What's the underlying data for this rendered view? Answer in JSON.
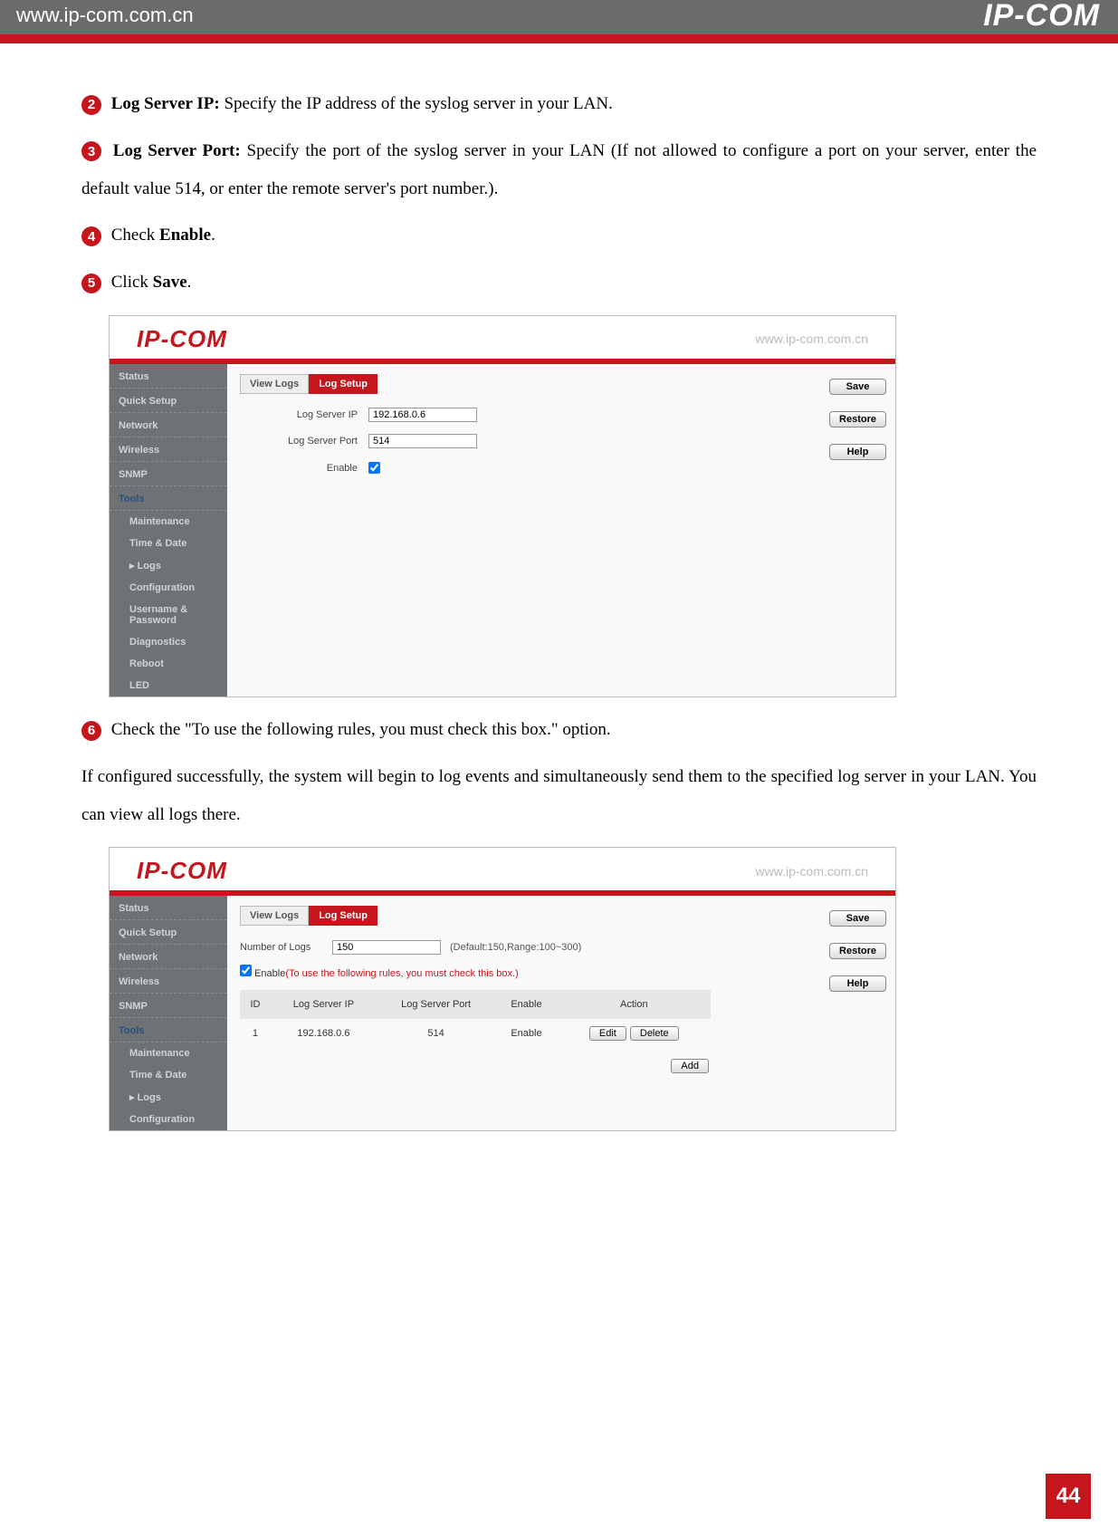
{
  "header": {
    "url": "www.ip-com.com.cn",
    "brand": "IP-COM"
  },
  "steps": {
    "s2_label": "Log Server IP:",
    "s2_text": " Specify the IP address of the syslog server in your LAN.",
    "s3_label": "Log Server Port:",
    "s3_text": " Specify the port of the syslog server in your LAN (If not allowed to configure a port on your server, enter the default value 514, or enter the remote server's port number.).",
    "s4_pre": "Check ",
    "s4_bold": "Enable",
    "s5_pre": "Click ",
    "s5_bold": "Save",
    "s6_text": " Check the \"To use the following rules, you must check this box.\" option.",
    "final": "If configured successfully, the system will begin to log events and simultaneously send them to the specified log server in your LAN. You can view all logs there."
  },
  "ss": {
    "logo": "IP-COM",
    "url": "www.ip-com.com.cn",
    "side": {
      "status": "Status",
      "quick": "Quick Setup",
      "network": "Network",
      "wireless": "Wireless",
      "snmp": "SNMP",
      "tools": "Tools",
      "maint": "Maintenance",
      "time": "Time & Date",
      "logs": "Logs",
      "config": "Configuration",
      "userpw": "Username & Password",
      "diag": "Diagnostics",
      "reboot": "Reboot",
      "led": "LED"
    },
    "tabs": {
      "view": "View Logs",
      "setup": "Log Setup"
    },
    "btn": {
      "save": "Save",
      "restore": "Restore",
      "help": "Help",
      "add": "Add",
      "edit": "Edit",
      "delete": "Delete"
    },
    "form1": {
      "ip_label": "Log Server IP",
      "ip_val": "192.168.0.6",
      "port_label": "Log Server Port",
      "port_val": "514",
      "enable_label": "Enable"
    },
    "form2": {
      "num_label": "Number of Logs",
      "num_val": "150",
      "num_hint": "(Default:150,Range:100~300)",
      "enable_label": "Enable",
      "enable_note": "(To use the following rules, you must check this box.)",
      "th_id": "ID",
      "th_ip": "Log Server IP",
      "th_port": "Log Server Port",
      "th_en": "Enable",
      "th_act": "Action",
      "row_id": "1",
      "row_ip": "192.168.0.6",
      "row_port": "514",
      "row_en": "Enable"
    }
  },
  "page_number": "44"
}
